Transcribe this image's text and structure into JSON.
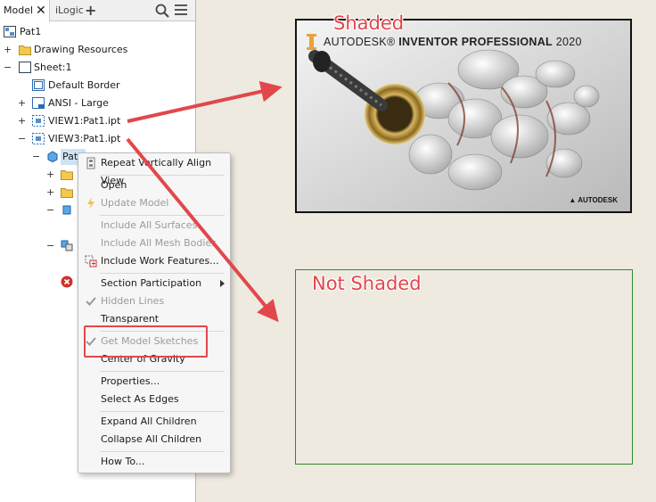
{
  "browser": {
    "tabs": {
      "model": "Model",
      "ilogic": "iLogic",
      "add": "+"
    },
    "close_glyph": "✕",
    "tree": {
      "root": "Pat1",
      "drawing_resources": "Drawing Resources",
      "sheet": "Sheet:1",
      "default_border": "Default Border",
      "ansi": "ANSI - Large",
      "view1": "VIEW1:Pat1.ipt",
      "view3": "VIEW3:Pat1.ipt",
      "selected_part": "Pat1"
    }
  },
  "context_menu": {
    "items": [
      {
        "label": "Repeat Vertically Align View",
        "disabled": false
      },
      {
        "label": "Open",
        "disabled": false
      },
      {
        "label": "Update Model",
        "disabled": true
      },
      {
        "label": "Include All Surfaces",
        "disabled": true
      },
      {
        "label": "Include All Mesh Bodies",
        "disabled": true
      },
      {
        "label": "Include Work Features...",
        "disabled": false
      },
      {
        "label": "Section Participation",
        "disabled": false
      },
      {
        "label": "Hidden Lines",
        "disabled": true
      },
      {
        "label": "Transparent",
        "disabled": false
      },
      {
        "label": "Get Model Sketches",
        "disabled": true
      },
      {
        "label": "Center of Gravity",
        "disabled": false
      },
      {
        "label": "Properties...",
        "disabled": false
      },
      {
        "label": "Select As Edges",
        "disabled": false
      },
      {
        "label": "Expand All Children",
        "disabled": false
      },
      {
        "label": "Collapse All Children",
        "disabled": false
      },
      {
        "label": "How To...",
        "disabled": false
      }
    ]
  },
  "canvas": {
    "shaded_label": "Shaded",
    "unshaded_label": "Not Shaded",
    "splash_brand": "AUTODESK",
    "splash_product": "INVENTOR PROFESSIONAL",
    "splash_year": "2020",
    "autodesk_mark": "AUTODESK"
  },
  "colors": {
    "callout": "#e2474b",
    "frame_green": "#2e8b2e",
    "canvas_bg": "#eeeae0"
  }
}
